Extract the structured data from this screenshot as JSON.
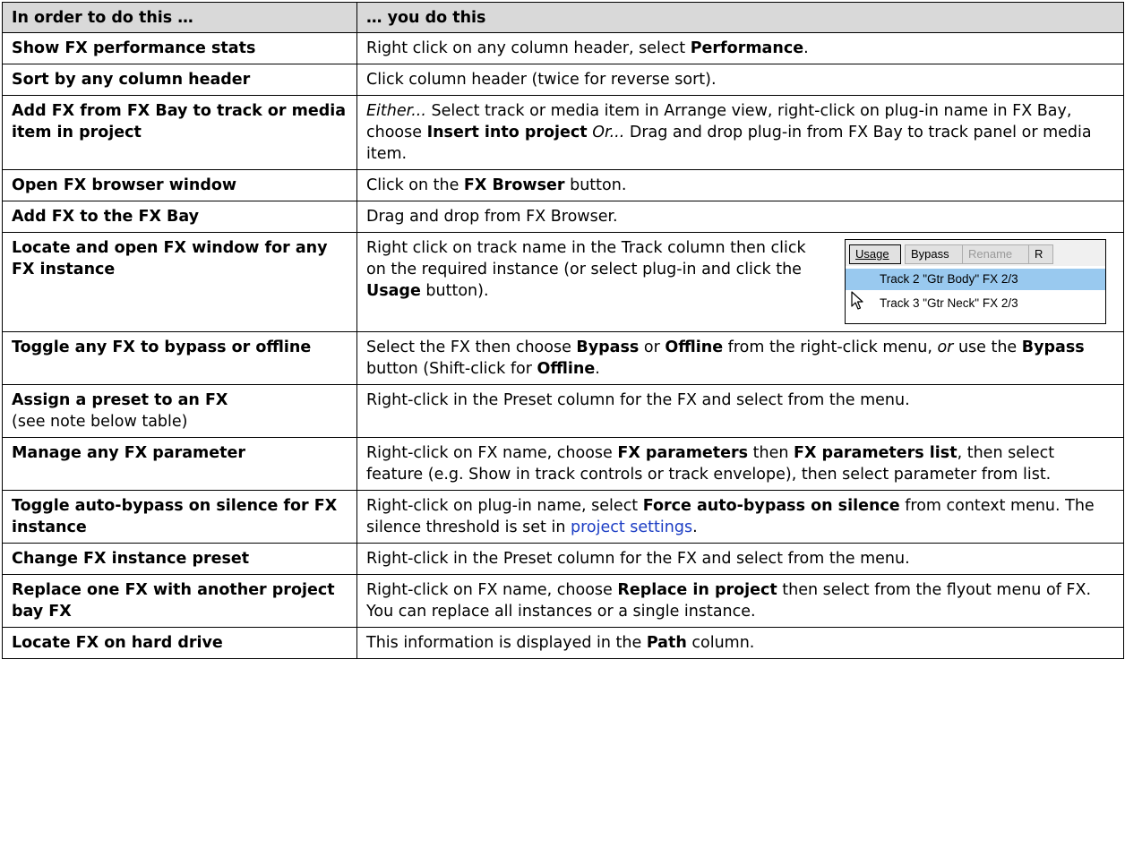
{
  "header": {
    "col1": "In order to do this …",
    "col2": "… you do this"
  },
  "rows": [
    {
      "task": "Show FX performance stats",
      "desc": [
        {
          "t": "Right click on any column header, select "
        },
        {
          "t": "Performance",
          "b": true
        },
        {
          "t": "."
        }
      ]
    },
    {
      "task": "Sort by any column header",
      "desc": [
        {
          "t": "Click column header (twice for reverse sort)."
        }
      ]
    },
    {
      "task": "Add FX from FX Bay to track or media item in project",
      "desc": [
        {
          "t": "Either...",
          "i": true
        },
        {
          "t": " Select track or media item in Arrange view, right-click on plug-in name in FX Bay, choose "
        },
        {
          "t": "Insert into project",
          "b": true
        },
        {
          "t": " "
        },
        {
          "t": "Or...",
          "i": true
        },
        {
          "t": " Drag and drop plug-in from FX Bay to track panel or media item."
        }
      ]
    },
    {
      "task": "Open FX browser window",
      "desc": [
        {
          "t": "Click on the "
        },
        {
          "t": "FX Browser",
          "b": true
        },
        {
          "t": " button."
        }
      ]
    },
    {
      "task": "Add FX to the FX Bay",
      "desc": [
        {
          "t": "Drag and drop from FX Browser."
        }
      ]
    },
    {
      "task": "Locate and open FX window for any FX instance",
      "desc": [
        {
          "t": "Right click on track name in the Track column then click on the required instance (or select plug-in and click the "
        },
        {
          "t": "Usage",
          "b": true
        },
        {
          "t": " button)."
        }
      ]
    },
    {
      "task": "Toggle any FX to bypass or offline",
      "desc": [
        {
          "t": "Select the FX then choose "
        },
        {
          "t": "Bypass",
          "b": true
        },
        {
          "t": " or "
        },
        {
          "t": "Offline",
          "b": true
        },
        {
          "t": " from the right-click menu, "
        },
        {
          "t": "or",
          "i": true
        },
        {
          "t": " use the "
        },
        {
          "t": "Bypass",
          "b": true
        },
        {
          "t": " button (Shift-click for "
        },
        {
          "t": "Offline",
          "b": true
        },
        {
          "t": "."
        }
      ]
    },
    {
      "task": "Assign a preset to an FX",
      "task_note": "(see note below table)",
      "desc": [
        {
          "t": "Right-click in the Preset column for the FX and select from the menu."
        }
      ]
    },
    {
      "task": "Manage any FX parameter",
      "desc": [
        {
          "t": "Right-click on FX name, choose "
        },
        {
          "t": "FX parameters",
          "b": true
        },
        {
          "t": " then "
        },
        {
          "t": "FX parameters list",
          "b": true
        },
        {
          "t": ", then select feature (e.g. Show in track controls or track envelope), then select parameter from list."
        }
      ]
    },
    {
      "task": "Toggle auto-bypass on silence for FX instance",
      "desc": [
        {
          "t": "Right-click on plug-in name, select "
        },
        {
          "t": "Force auto-bypass on silence",
          "b": true
        },
        {
          "t": " from context menu. The silence threshold is set in "
        },
        {
          "t": "project settings",
          "link": true
        },
        {
          "t": "."
        }
      ]
    },
    {
      "task": "Change FX instance preset",
      "desc": [
        {
          "t": "Right-click in the Preset column for the FX and select from the menu."
        }
      ]
    },
    {
      "task": "Replace one FX with another project bay FX",
      "desc": [
        {
          "t": "Right-click on FX name, choose "
        },
        {
          "t": "Replace in project",
          "b": true
        },
        {
          "t": " then select from the flyout menu of FX. You can replace all instances or a single instance."
        }
      ]
    },
    {
      "task": "Locate FX on hard drive",
      "desc": [
        {
          "t": "This information is displayed in the "
        },
        {
          "t": "Path",
          "b": true
        },
        {
          "t": " column."
        }
      ]
    }
  ],
  "inset": {
    "buttons": [
      "Usage",
      "Bypass",
      "Rename",
      "R"
    ],
    "items": [
      "Track 2 \"Gtr Body\"  FX 2/3",
      "Track 3 \"Gtr Neck\"  FX 2/3"
    ]
  }
}
